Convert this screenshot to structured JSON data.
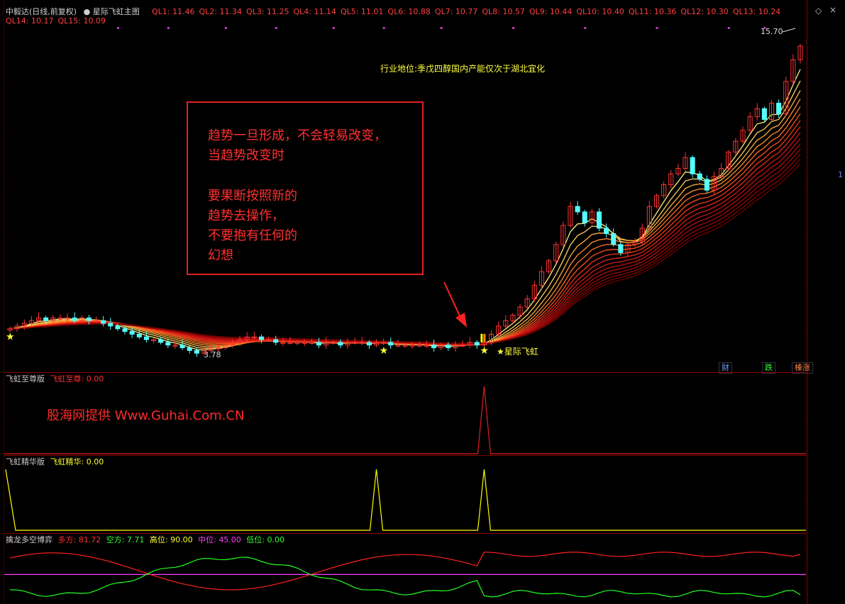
{
  "header": {
    "stock_label": "中毅达(日线,前复权)",
    "formula_label": "星际飞虹主图",
    "ql": [
      {
        "name": "QL1",
        "value": "11.46"
      },
      {
        "name": "QL2",
        "value": "11.34"
      },
      {
        "name": "QL3",
        "value": "11.25"
      },
      {
        "name": "QL4",
        "value": "11.14"
      },
      {
        "name": "QL5",
        "value": "11.01"
      },
      {
        "name": "QL6",
        "value": "10.88"
      },
      {
        "name": "QL7",
        "value": "10.77"
      },
      {
        "name": "QL8",
        "value": "10.57"
      },
      {
        "name": "QL9",
        "value": "10.44"
      },
      {
        "name": "QL10",
        "value": "10.40"
      },
      {
        "name": "QL11",
        "value": "10.36"
      },
      {
        "name": "QL12",
        "value": "10.30"
      },
      {
        "name": "QL13",
        "value": "10.24"
      },
      {
        "name": "QL14",
        "value": "10.17"
      },
      {
        "name": "QL15",
        "value": "10.09"
      }
    ],
    "btn_restore": "◇",
    "btn_close": "×"
  },
  "main": {
    "high_label": "15.70",
    "low_label": "3.78",
    "industry_note": "行业地位:季戊四醇国内产能仅次于湖北宜化",
    "signal_label": "★星际飞虹",
    "annotation": {
      "line1": "趋势一旦形成，不会轻易改变，",
      "line2": "当趋势改变时",
      "line3": "要果断按照新的",
      "line4": "趋势去操作，",
      "line5": "不要抱有任何的",
      "line6": "幻想"
    },
    "badges": {
      "cai": "财",
      "die": "跌",
      "zhang": "榛涨"
    },
    "right_marker": "1"
  },
  "panel1": {
    "title": "飞虹至尊版",
    "series_name": "飞虹至尊",
    "value": "0.00",
    "watermark": "股海网提供 Www.Guhai.Com.CN"
  },
  "panel2": {
    "title": "飞虹精华版",
    "series_name": "飞虹精华",
    "value": "0.00"
  },
  "panel3": {
    "title": "擒龙多空博弈",
    "items": [
      {
        "name": "多方",
        "value": "81.72"
      },
      {
        "name": "空方",
        "value": "7.71"
      },
      {
        "name": "高位",
        "value": "90.00"
      },
      {
        "name": "中位",
        "value": "45.00"
      },
      {
        "name": "低位",
        "value": "0.00"
      }
    ]
  },
  "colors": {
    "up": "#ff3232",
    "down": "#54ffff",
    "ribbon": "#ff6a1a",
    "panel1_line": "#e02020",
    "panel2_line": "#ffff00",
    "bull": "#ff2020",
    "bear": "#20ff20",
    "mid": "#ff40ff"
  },
  "chart_data": [
    {
      "type": "candlestick",
      "price_range": [
        3.78,
        15.7
      ],
      "signal_bars": [
        0,
        52,
        66
      ],
      "close_approx": [
        4.7,
        4.8,
        4.9,
        5.0,
        5.1,
        5.0,
        5.1,
        5.1,
        5.1,
        5.0,
        5.1,
        5.0,
        5.0,
        4.9,
        4.8,
        4.7,
        4.6,
        4.5,
        4.4,
        4.3,
        4.3,
        4.2,
        4.1,
        4.1,
        4.0,
        3.9,
        3.8,
        3.9,
        4.0,
        4.0,
        4.1,
        4.2,
        4.3,
        4.4,
        4.4,
        4.3,
        4.3,
        4.2,
        4.2,
        4.2,
        4.2,
        4.2,
        4.2,
        4.1,
        4.2,
        4.2,
        4.1,
        4.2,
        4.2,
        4.2,
        4.1,
        4.2,
        4.2,
        4.1,
        4.1,
        4.1,
        4.1,
        4.1,
        4.1,
        4.0,
        4.1,
        4.0,
        4.1,
        4.1,
        4.2,
        4.1,
        4.2,
        4.5,
        4.8,
        5.0,
        5.2,
        5.5,
        5.8,
        6.3,
        6.8,
        7.2,
        7.8,
        8.5,
        9.2,
        9.0,
        8.6,
        9.0,
        8.4,
        8.2,
        7.8,
        7.5,
        7.8,
        7.9,
        8.4,
        9.2,
        9.6,
        10.0,
        10.4,
        10.6,
        11.0,
        10.4,
        10.2,
        9.8,
        10.3,
        10.6,
        11.2,
        11.6,
        12.0,
        12.5,
        12.8,
        12.4,
        13.0,
        12.6,
        13.8,
        14.6,
        15.1
      ]
    },
    {
      "type": "line",
      "name": "飞虹至尊",
      "peaks": [
        66
      ]
    },
    {
      "type": "line",
      "name": "飞虹精华",
      "peaks": [
        0,
        51,
        66
      ]
    },
    {
      "type": "line",
      "name": "擒龙多空博弈",
      "series": [
        {
          "name": "多方",
          "last": 81.72
        },
        {
          "name": "空方",
          "last": 7.71
        }
      ],
      "levels": {
        "high": 90,
        "mid": 45,
        "low": 0
      }
    }
  ]
}
